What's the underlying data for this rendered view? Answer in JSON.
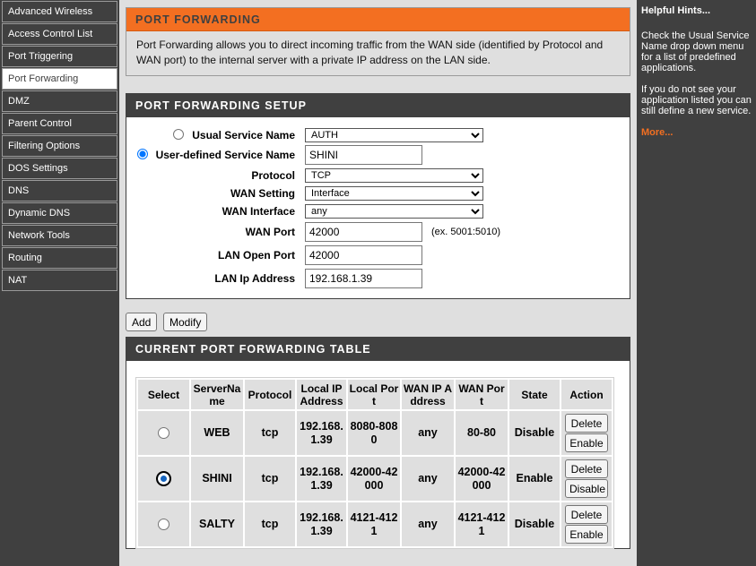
{
  "sidebar": {
    "items": [
      {
        "label": "Advanced Wireless"
      },
      {
        "label": "Access Control List"
      },
      {
        "label": "Port Triggering"
      },
      {
        "label": "Port Forwarding"
      },
      {
        "label": "DMZ"
      },
      {
        "label": "Parent Control"
      },
      {
        "label": "Filtering Options"
      },
      {
        "label": "DOS Settings"
      },
      {
        "label": "DNS"
      },
      {
        "label": "Dynamic DNS"
      },
      {
        "label": "Network Tools"
      },
      {
        "label": "Routing"
      },
      {
        "label": "NAT"
      }
    ],
    "active": "Port Forwarding"
  },
  "intro": {
    "title": "PORT FORWARDING",
    "text": "Port Forwarding allows you to direct incoming traffic from the WAN side (identified by Protocol and WAN port) to the internal server with a private IP address on the LAN side."
  },
  "setup": {
    "title": "PORT FORWARDING SETUP",
    "usual_service_label": "Usual Service Name",
    "usual_service_value": "AUTH",
    "user_defined_label": "User-defined Service Name",
    "user_defined_value": "SHINI",
    "protocol_label": "Protocol",
    "protocol_value": "TCP",
    "wan_setting_label": "WAN Setting",
    "wan_setting_value": "Interface",
    "wan_interface_label": "WAN Interface",
    "wan_interface_value": "any",
    "wan_port_label": "WAN Port",
    "wan_port_value": "42000",
    "wan_port_hint": "(ex. 5001:5010)",
    "lan_open_port_label": "LAN Open Port",
    "lan_open_port_value": "42000",
    "lan_ip_label": "LAN Ip Address",
    "lan_ip_value": "192.168.1.39",
    "selected_mode": "user-defined"
  },
  "actions": {
    "add_label": "Add",
    "modify_label": "Modify"
  },
  "table": {
    "title": "CURRENT PORT FORWARDING TABLE",
    "headers": {
      "select": "Select",
      "server": "ServerNa me",
      "protocol": "Protocol",
      "local_ip": "Local IP Address",
      "local_port": "Local Por t",
      "wan_ip": "WAN IP A ddress",
      "wan_port": "WAN Por t",
      "state": "State",
      "action": "Action"
    },
    "rows": [
      {
        "server": "WEB",
        "protocol": "tcp",
        "local_ip": "192.168. 1.39",
        "local_port": "8080-808 0",
        "wan_ip": "any",
        "wan_port": "80-80",
        "state": "Disable",
        "delete": "Delete",
        "toggle": "Enable",
        "selected": false
      },
      {
        "server": "SHINI",
        "protocol": "tcp",
        "local_ip": "192.168. 1.39",
        "local_port": "42000-42 000",
        "wan_ip": "any",
        "wan_port": "42000-42 000",
        "state": "Enable",
        "delete": "Delete",
        "toggle": "Disable",
        "selected": true
      },
      {
        "server": "SALTY",
        "protocol": "tcp",
        "local_ip": "192.168. 1.39",
        "local_port": "4121-412 1",
        "wan_ip": "any",
        "wan_port": "4121-412 1",
        "state": "Disable",
        "delete": "Delete",
        "toggle": "Enable",
        "selected": false
      }
    ]
  },
  "hints": {
    "title": "Helpful Hints...",
    "p1": "Check the Usual Service Name drop down menu for a list of predefined applications.",
    "p2": "If you do not see your application listed you can still define a new service.",
    "more": "More..."
  },
  "colors": {
    "accent": "#f36f21",
    "dark": "#404040",
    "panel": "#dfdfdf"
  }
}
